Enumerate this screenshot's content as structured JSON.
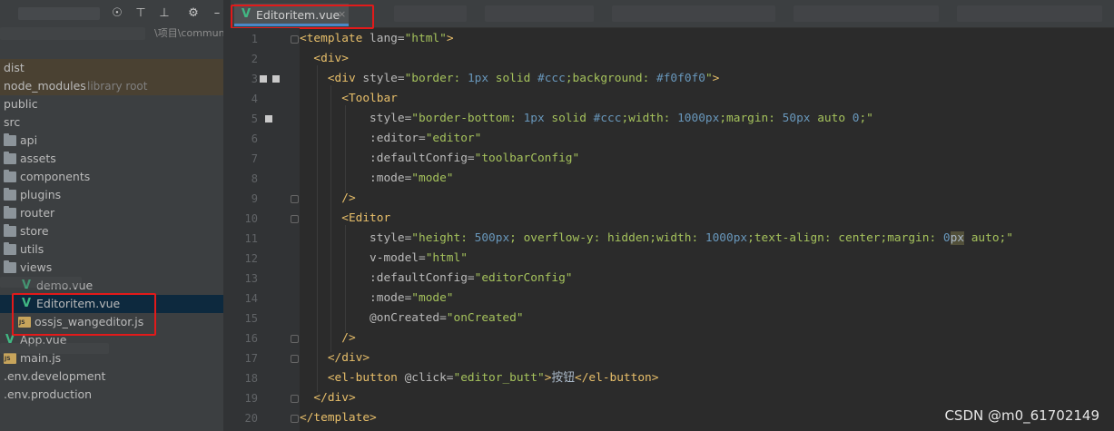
{
  "project_panel": {
    "toolbar_icons": [
      "globe-icon",
      "collapse-all-icon",
      "expand-all-icon",
      "gear-icon",
      "minimize-icon"
    ],
    "path_fragment": "\\项目\\commun",
    "items": [
      {
        "label": "dist",
        "icon": "none",
        "style": "dimmed"
      },
      {
        "label": "node_modules",
        "suffix": "library root",
        "icon": "none",
        "style": "dimmed"
      },
      {
        "label": "public",
        "icon": "none",
        "style": "normal"
      },
      {
        "label": "src",
        "icon": "none",
        "style": "normal"
      },
      {
        "label": "api",
        "icon": "folder-icon",
        "style": "normal"
      },
      {
        "label": "assets",
        "icon": "folder-icon",
        "style": "normal"
      },
      {
        "label": "components",
        "icon": "folder-icon",
        "style": "normal"
      },
      {
        "label": "plugins",
        "icon": "folder-icon",
        "style": "normal"
      },
      {
        "label": "router",
        "icon": "folder-icon",
        "style": "normal"
      },
      {
        "label": "store",
        "icon": "folder-icon",
        "style": "normal"
      },
      {
        "label": "utils",
        "icon": "folder-icon",
        "style": "normal"
      },
      {
        "label": "views",
        "icon": "folder-icon",
        "style": "normal"
      },
      {
        "label": "demo.vue",
        "icon": "vue-icon",
        "style": "normal"
      },
      {
        "label": "Editoritem.vue",
        "icon": "vue-icon",
        "style": "selected"
      },
      {
        "label": "ossjs_wangeditor.js",
        "icon": "js-icon",
        "style": "normal"
      },
      {
        "label": "App.vue",
        "icon": "vue-icon",
        "style": "normal"
      },
      {
        "label": "main.js",
        "icon": "js-icon",
        "style": "normal"
      },
      {
        "label": ".env.development",
        "icon": "none",
        "style": "normal"
      },
      {
        "label": ".env.production",
        "icon": "none",
        "style": "normal"
      }
    ]
  },
  "editor": {
    "tab": {
      "label": "Editoritem.vue",
      "close": "×",
      "icon": "vue-icon"
    },
    "line_numbers": [
      "1",
      "2",
      "3",
      "4",
      "5",
      "6",
      "7",
      "8",
      "9",
      "10",
      "11",
      "12",
      "13",
      "14",
      "15",
      "16",
      "17",
      "18",
      "19",
      "20"
    ],
    "lines": [
      [
        [
          "tag",
          "<template "
        ],
        [
          "attr",
          "lang="
        ],
        [
          "val",
          "\"html\""
        ],
        [
          "tag",
          ">"
        ]
      ],
      [
        [
          "txt",
          "  "
        ],
        [
          "tag",
          "<div>"
        ]
      ],
      [
        [
          "txt",
          "    "
        ],
        [
          "tag",
          "<div "
        ],
        [
          "attr",
          "style="
        ],
        [
          "val",
          "\"border: "
        ],
        [
          "num",
          "1px"
        ],
        [
          "val",
          " solid "
        ],
        [
          "num",
          "#ccc"
        ],
        [
          "val",
          ";background: "
        ],
        [
          "num",
          "#f0f0f0"
        ],
        [
          "val",
          "\""
        ],
        [
          "tag",
          ">"
        ]
      ],
      [
        [
          "txt",
          "      "
        ],
        [
          "tag",
          "<Toolbar"
        ]
      ],
      [
        [
          "txt",
          "          "
        ],
        [
          "attr",
          "style="
        ],
        [
          "val",
          "\"border-bottom: "
        ],
        [
          "num",
          "1px"
        ],
        [
          "val",
          " solid "
        ],
        [
          "num",
          "#ccc"
        ],
        [
          "val",
          ";width: "
        ],
        [
          "num",
          "1000px"
        ],
        [
          "val",
          ";margin: "
        ],
        [
          "num",
          "50px"
        ],
        [
          "val",
          " auto "
        ],
        [
          "num",
          "0"
        ],
        [
          "val",
          ";\""
        ]
      ],
      [
        [
          "txt",
          "          "
        ],
        [
          "attr",
          ":editor="
        ],
        [
          "val",
          "\"editor\""
        ]
      ],
      [
        [
          "txt",
          "          "
        ],
        [
          "attr",
          ":defaultConfig="
        ],
        [
          "val",
          "\"toolbarConfig\""
        ]
      ],
      [
        [
          "txt",
          "          "
        ],
        [
          "attr",
          ":mode="
        ],
        [
          "val",
          "\"mode\""
        ]
      ],
      [
        [
          "txt",
          "      "
        ],
        [
          "tag",
          "/>"
        ]
      ],
      [
        [
          "txt",
          "      "
        ],
        [
          "tag",
          "<Editor"
        ]
      ],
      [
        [
          "txt",
          "          "
        ],
        [
          "attr",
          "style="
        ],
        [
          "val",
          "\"height: "
        ],
        [
          "num",
          "500px"
        ],
        [
          "val",
          "; overflow-y: hidden;width: "
        ],
        [
          "num",
          "1000px"
        ],
        [
          "val",
          ";text-align: center;margin: "
        ],
        [
          "num",
          "0"
        ],
        [
          "hl",
          "px"
        ],
        [
          "val",
          " auto;\""
        ]
      ],
      [
        [
          "txt",
          "          "
        ],
        [
          "attr",
          "v-model="
        ],
        [
          "val",
          "\"html\""
        ]
      ],
      [
        [
          "txt",
          "          "
        ],
        [
          "attr",
          ":defaultConfig="
        ],
        [
          "val",
          "\"editorConfig\""
        ]
      ],
      [
        [
          "txt",
          "          "
        ],
        [
          "attr",
          ":mode="
        ],
        [
          "val",
          "\"mode\""
        ]
      ],
      [
        [
          "txt",
          "          "
        ],
        [
          "attr",
          "@onCreated="
        ],
        [
          "val",
          "\"onCreated\""
        ]
      ],
      [
        [
          "txt",
          "      "
        ],
        [
          "tag",
          "/>"
        ]
      ],
      [
        [
          "txt",
          "    "
        ],
        [
          "tag",
          "</div>"
        ]
      ],
      [
        [
          "txt",
          "    "
        ],
        [
          "tag",
          "<el-button "
        ],
        [
          "attr",
          "@click="
        ],
        [
          "val",
          "\"editor_butt\""
        ],
        [
          "tag",
          ">"
        ],
        [
          "txt",
          "按钮"
        ],
        [
          "tag",
          "</el-button>"
        ]
      ],
      [
        [
          "txt",
          "  "
        ],
        [
          "tag",
          "</div>"
        ]
      ],
      [
        [
          "tag",
          "</template>"
        ]
      ]
    ]
  },
  "watermark": "CSDN @m0_61702149",
  "colors": {
    "highlight_box": "#e21a1a",
    "vue_green": "#41b883",
    "tag": "#e8bf6a",
    "string": "#a5c25c",
    "number": "#6897bb"
  }
}
